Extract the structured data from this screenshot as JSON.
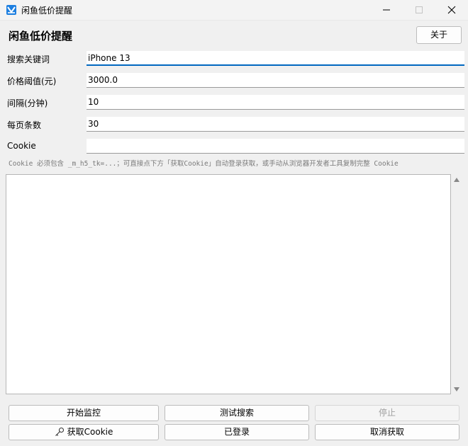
{
  "window": {
    "title": "闲鱼低价提醒",
    "minimize_icon": "minimize-icon",
    "maximize_icon": "maximize-icon",
    "close_icon": "close-icon"
  },
  "header": {
    "title": "闲鱼低价提醒",
    "about_label": "关于"
  },
  "form": {
    "keyword": {
      "label": "搜索关键词",
      "value": "iPhone 13"
    },
    "price": {
      "label": "价格阈值(元)",
      "value": "3000.0"
    },
    "interval": {
      "label": "间隔(分钟)",
      "value": "10"
    },
    "page_size": {
      "label": "每页条数",
      "value": "30"
    },
    "cookie": {
      "label": "Cookie",
      "value": ""
    }
  },
  "hint": "Cookie 必须包含 _m_h5_tk=...；可直接点下方「获取Cookie」自动登录获取，或手动从浏览器开发者工具复制完整 Cookie",
  "log": {
    "text": ""
  },
  "buttons": {
    "start": "开始监控",
    "test_search": "测试搜索",
    "stop": "停止",
    "get_cookie": "获取Cookie",
    "logged_in": "已登录",
    "cancel_get": "取消获取"
  },
  "colors": {
    "accent": "#0067c0",
    "app_icon": "#1d7fe0",
    "background": "#f0f0f0",
    "disabled_text": "#a0a0a0"
  }
}
